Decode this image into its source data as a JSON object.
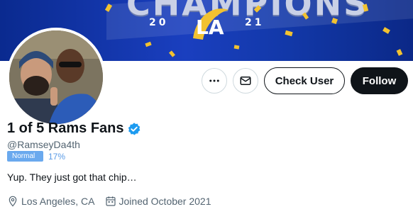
{
  "banner": {
    "title": "CHAMPIONS",
    "year_left": "20",
    "year_right": "21",
    "colors": {
      "primary": "#1238a8",
      "gold": "#f2c230"
    }
  },
  "profile": {
    "display_name": "1 of 5 Rams Fans",
    "handle": "@RamseyDa4th",
    "status_badge": "Normal",
    "status_percent": "17%",
    "bio": "Yup. They just got that chip…",
    "location": "Los Angeles, CA",
    "joined": "Joined October 2021"
  },
  "actions": {
    "more_icon": "more-horizontal-icon",
    "message_icon": "mail-icon",
    "check_user_label": "Check User",
    "follow_label": "Follow"
  },
  "colors": {
    "accent": "#1d9bf0",
    "badge": "#6aa9ee",
    "follow_bg": "#0f1419"
  }
}
